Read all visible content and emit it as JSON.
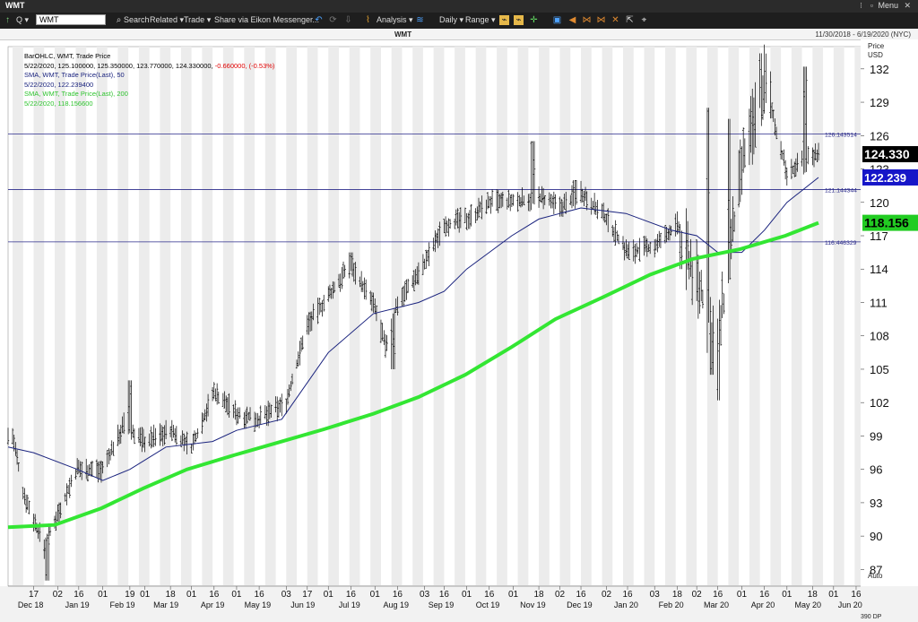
{
  "window": {
    "title": "WMT",
    "menu_label": "Menu"
  },
  "toolbar": {
    "symbol": "WMT",
    "search": "Search",
    "related": "Related",
    "trade": "Trade",
    "share": "Share via Eikon Messenger...",
    "analysis": "Analysis",
    "interval": "Daily",
    "range": "Range"
  },
  "chart_header": {
    "symbol": "WMT",
    "date_range": "11/30/2018 - 6/19/2020 (NYC)"
  },
  "legend": {
    "line1": "BarOHLC, WMT, Trade Price",
    "line2_prefix": "5/22/2020, 125.100000, 125.350000, 123.770000, 124.330000,",
    "line2_change": "-0.660000, (-0.53%)",
    "line3": "SMA, WMT, Trade Price(Last), 50",
    "line4": "5/22/2020, 122.239400",
    "line5": "SMA, WMT, Trade Price(Last), 200",
    "line6": "5/22/2020, 118.156600"
  },
  "axis": {
    "price_label": "Price",
    "currency": "USD",
    "auto": "Auto",
    "dp": "390 DP",
    "y_ticks": [
      "87",
      "90",
      "93",
      "96",
      "99",
      "102",
      "105",
      "108",
      "111",
      "114",
      "117",
      "120",
      "123",
      "126",
      "129",
      "132"
    ]
  },
  "tags": {
    "last": "124.330",
    "sma50": "122.239",
    "sma200": "118.156"
  },
  "hlines": [
    "126.143514",
    "121.144344",
    "116.446329"
  ],
  "colors": {
    "bars": "#000000",
    "sma50": "#1a237e",
    "sma200": "#33e633",
    "hline": "#2a2a8a",
    "last_tag": "#000000",
    "sma50_tag": "#1616c8",
    "sma200_tag": "#22cc22"
  },
  "chart_data": {
    "type": "ohlc",
    "title": "WMT",
    "ylabel": "Price USD",
    "ylim": [
      85.5,
      134
    ],
    "x_range": [
      "11/30/2018",
      "6/19/2020"
    ],
    "x_ticks": [
      "17",
      "02",
      "16",
      "01",
      "19",
      "01",
      "18",
      "01",
      "16",
      "01",
      "16",
      "03",
      "17",
      "01",
      "16",
      "01",
      "16",
      "03",
      "16",
      "01",
      "16",
      "01",
      "18",
      "02",
      "16",
      "02",
      "16",
      "03",
      "18",
      "02",
      "16",
      "01",
      "16",
      "01",
      "18",
      "01",
      "16"
    ],
    "x_months": [
      "Dec 18",
      "Jan 19",
      "Feb 19",
      "Mar 19",
      "Apr 19",
      "May 19",
      "Jun 19",
      "Jul 19",
      "Aug 19",
      "Sep 19",
      "Oct 19",
      "Nov 19",
      "Dec 19",
      "Jan 20",
      "Feb 20",
      "Mar 20",
      "Apr 20",
      "May 20",
      "Jun 20"
    ],
    "last_bar": {
      "date": "5/22/2020",
      "open": 125.1,
      "high": 125.35,
      "low": 123.77,
      "close": 124.33,
      "change": -0.66,
      "change_pct": -0.53
    },
    "horizontal_lines": [
      126.143514,
      121.144344,
      116.446329
    ],
    "close_path": [
      {
        "date": "2018-12-03",
        "close": 99.0
      },
      {
        "date": "2018-12-10",
        "close": 94.0
      },
      {
        "date": "2018-12-17",
        "close": 91.5
      },
      {
        "date": "2018-12-24",
        "close": 89.0
      },
      {
        "date": "2019-01-02",
        "close": 92.0
      },
      {
        "date": "2019-01-15",
        "close": 96.0
      },
      {
        "date": "2019-02-01",
        "close": 96.0
      },
      {
        "date": "2019-02-15",
        "close": 100.0
      },
      {
        "date": "2019-03-01",
        "close": 98.5
      },
      {
        "date": "2019-03-18",
        "close": 99.5
      },
      {
        "date": "2019-04-01",
        "close": 98.0
      },
      {
        "date": "2019-04-16",
        "close": 103.0
      },
      {
        "date": "2019-05-01",
        "close": 101.0
      },
      {
        "date": "2019-05-16",
        "close": 100.5
      },
      {
        "date": "2019-06-03",
        "close": 102.0
      },
      {
        "date": "2019-06-17",
        "close": 109.0
      },
      {
        "date": "2019-07-01",
        "close": 111.5
      },
      {
        "date": "2019-07-16",
        "close": 114.5
      },
      {
        "date": "2019-08-01",
        "close": 110.5
      },
      {
        "date": "2019-08-08",
        "close": 107.0
      },
      {
        "date": "2019-08-16",
        "close": 111.0
      },
      {
        "date": "2019-09-03",
        "close": 114.5
      },
      {
        "date": "2019-09-16",
        "close": 118.0
      },
      {
        "date": "2019-10-01",
        "close": 118.5
      },
      {
        "date": "2019-10-16",
        "close": 120.0
      },
      {
        "date": "2019-11-01",
        "close": 120.0
      },
      {
        "date": "2019-11-18",
        "close": 120.5
      },
      {
        "date": "2019-12-02",
        "close": 119.5
      },
      {
        "date": "2019-12-16",
        "close": 121.0
      },
      {
        "date": "2020-01-02",
        "close": 118.5
      },
      {
        "date": "2020-01-16",
        "close": 115.5
      },
      {
        "date": "2020-02-03",
        "close": 116.0
      },
      {
        "date": "2020-02-18",
        "close": 118.0
      },
      {
        "date": "2020-03-02",
        "close": 113.0
      },
      {
        "date": "2020-03-16",
        "close": 107.0
      },
      {
        "date": "2020-04-01",
        "close": 123.0
      },
      {
        "date": "2020-04-16",
        "close": 131.0
      },
      {
        "date": "2020-05-01",
        "close": 122.5
      },
      {
        "date": "2020-05-18",
        "close": 124.3
      }
    ],
    "series": [
      {
        "name": "SMA, WMT, Trade Price(Last), 50",
        "points": [
          {
            "date": "2018-11-30",
            "value": 98.0
          },
          {
            "date": "2018-12-17",
            "value": 97.5
          },
          {
            "date": "2019-01-15",
            "value": 96.0
          },
          {
            "date": "2019-02-01",
            "value": 95.0
          },
          {
            "date": "2019-02-19",
            "value": 96.0
          },
          {
            "date": "2019-03-15",
            "value": 98.0
          },
          {
            "date": "2019-04-15",
            "value": 98.5
          },
          {
            "date": "2019-05-01",
            "value": 99.5
          },
          {
            "date": "2019-05-31",
            "value": 100.5
          },
          {
            "date": "2019-07-01",
            "value": 106.5
          },
          {
            "date": "2019-07-31",
            "value": 110.0
          },
          {
            "date": "2019-08-30",
            "value": 111.0
          },
          {
            "date": "2019-09-16",
            "value": 112.0
          },
          {
            "date": "2019-10-01",
            "value": 114.0
          },
          {
            "date": "2019-10-31",
            "value": 117.0
          },
          {
            "date": "2019-11-18",
            "value": 118.5
          },
          {
            "date": "2019-12-02",
            "value": 119.0
          },
          {
            "date": "2019-12-16",
            "value": 119.5
          },
          {
            "date": "2020-01-15",
            "value": 119.0
          },
          {
            "date": "2020-02-14",
            "value": 117.5
          },
          {
            "date": "2020-03-02",
            "value": 117.0
          },
          {
            "date": "2020-03-16",
            "value": 115.5
          },
          {
            "date": "2020-04-01",
            "value": 115.5
          },
          {
            "date": "2020-04-16",
            "value": 117.5
          },
          {
            "date": "2020-05-01",
            "value": 120.0
          },
          {
            "date": "2020-05-22",
            "value": 122.24
          }
        ]
      },
      {
        "name": "SMA, WMT, Trade Price(Last), 200",
        "points": [
          {
            "date": "2018-11-30",
            "value": 90.8
          },
          {
            "date": "2018-12-31",
            "value": 91.0
          },
          {
            "date": "2019-01-31",
            "value": 92.5
          },
          {
            "date": "2019-02-28",
            "value": 94.3
          },
          {
            "date": "2019-03-29",
            "value": 96.0
          },
          {
            "date": "2019-04-30",
            "value": 97.3
          },
          {
            "date": "2019-05-31",
            "value": 98.5
          },
          {
            "date": "2019-06-28",
            "value": 99.6
          },
          {
            "date": "2019-07-31",
            "value": 101.0
          },
          {
            "date": "2019-08-30",
            "value": 102.5
          },
          {
            "date": "2019-09-30",
            "value": 104.5
          },
          {
            "date": "2019-10-31",
            "value": 107.0
          },
          {
            "date": "2019-11-29",
            "value": 109.5
          },
          {
            "date": "2019-12-31",
            "value": 111.5
          },
          {
            "date": "2020-01-31",
            "value": 113.5
          },
          {
            "date": "2020-02-28",
            "value": 114.9
          },
          {
            "date": "2020-03-31",
            "value": 115.8
          },
          {
            "date": "2020-04-30",
            "value": 117.0
          },
          {
            "date": "2020-05-22",
            "value": 118.16
          }
        ]
      }
    ],
    "extremes": [
      {
        "date": "2018-12-26",
        "low": 86.0
      },
      {
        "date": "2019-02-19",
        "high": 104.0
      },
      {
        "date": "2019-07-16",
        "high": 115.5
      },
      {
        "date": "2019-08-13",
        "low": 105.0
      },
      {
        "date": "2019-11-14",
        "high": 125.5
      },
      {
        "date": "2019-12-12",
        "high": 122.0
      },
      {
        "date": "2020-02-21",
        "low": 114.0
      },
      {
        "date": "2020-03-09",
        "high": 128.5
      },
      {
        "date": "2020-03-16",
        "low": 102.2
      },
      {
        "date": "2020-03-12",
        "low": 104.5
      },
      {
        "date": "2020-03-23",
        "high": 127.5
      },
      {
        "date": "2020-04-13",
        "high": 133.4
      },
      {
        "date": "2020-05-13",
        "high": 132.2
      }
    ]
  }
}
